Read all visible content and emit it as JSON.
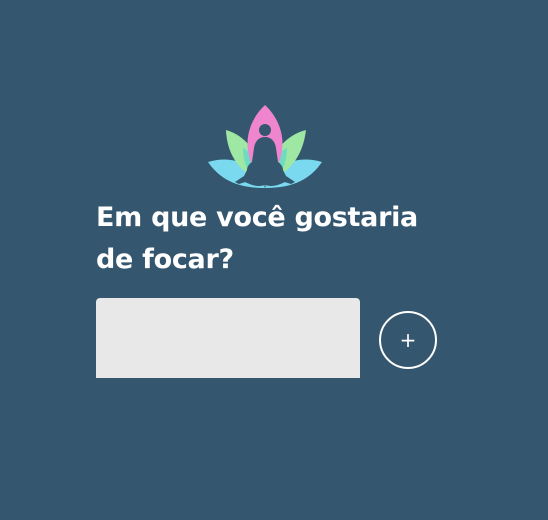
{
  "logo": {
    "icon": "meditation-lotus-icon",
    "colors": {
      "pink": "#ef85cf",
      "green": "#9fe8a3",
      "teal": "#6fdcc2",
      "cyan": "#7ad8ef",
      "silhouette": "#35566f"
    }
  },
  "prompt": {
    "text": "Em que você gostaria de focar?"
  },
  "focus_input": {
    "value": "",
    "placeholder": ""
  },
  "add_button": {
    "label": "+"
  },
  "colors": {
    "background": "#35566f",
    "text": "#ffffff",
    "input_background": "#e8e8e8"
  }
}
